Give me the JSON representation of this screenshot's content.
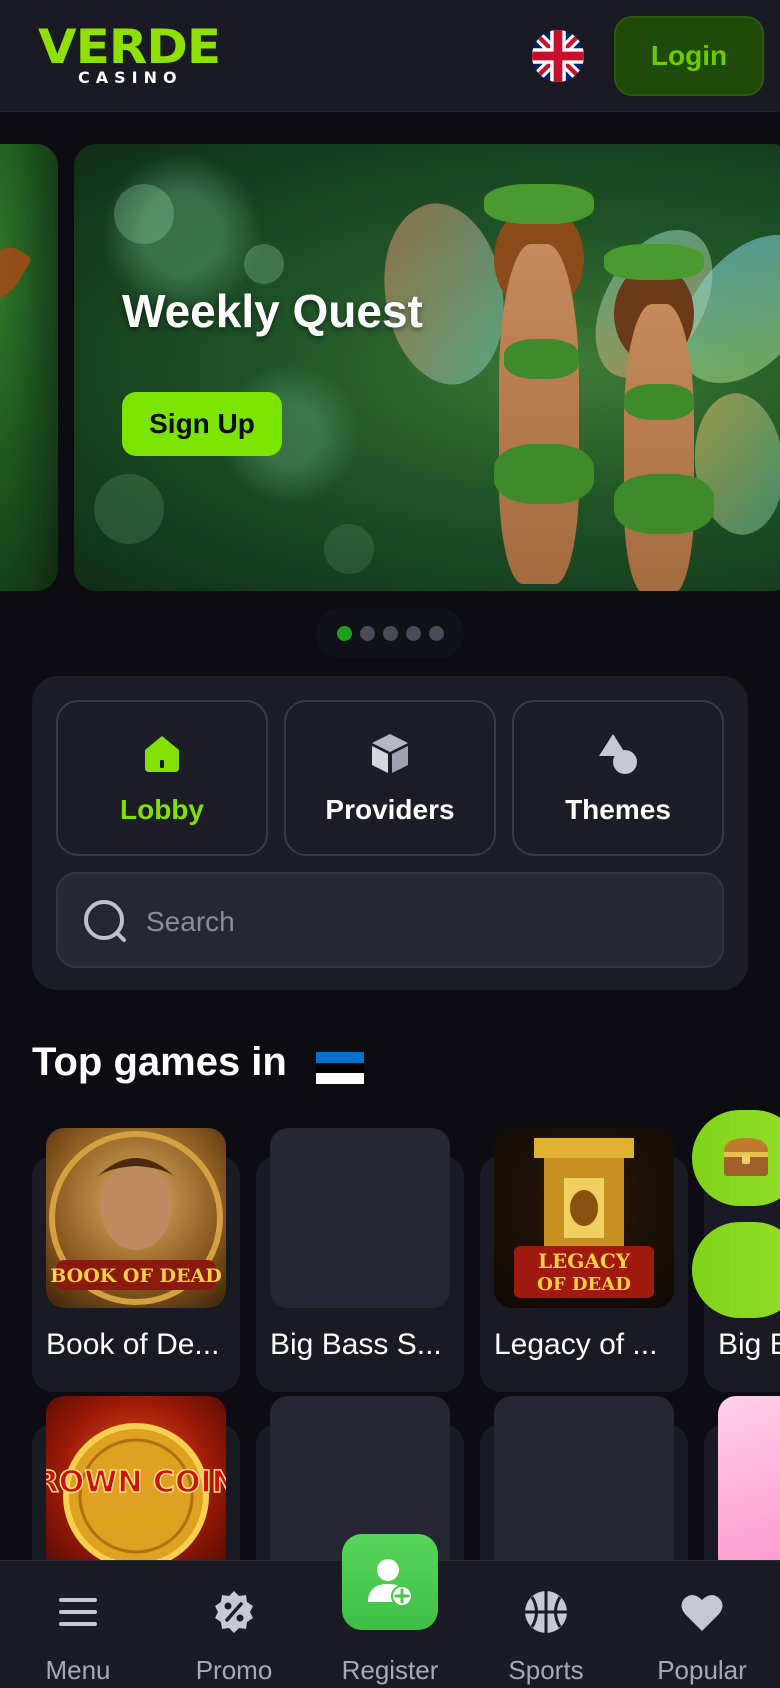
{
  "brand": {
    "name": "VERDE",
    "subtitle": "CASINO"
  },
  "header": {
    "login_label": "Login",
    "language_flag": "uk-flag-icon"
  },
  "banner": {
    "title": "Weekly Quest",
    "cta_label": "Sign Up",
    "slides": 5,
    "active_slide": 1
  },
  "nav": {
    "items": [
      {
        "label": "Lobby",
        "icon": "home-icon",
        "active": true
      },
      {
        "label": "Providers",
        "icon": "cube-icon",
        "active": false
      },
      {
        "label": "Themes",
        "icon": "shapes-icon",
        "active": false
      }
    ]
  },
  "search": {
    "placeholder": "Search"
  },
  "top_games": {
    "title": "Top games in",
    "country_flag": "estonia-flag-icon",
    "games": [
      {
        "name": "Book of De..."
      },
      {
        "name": "Big Bass S..."
      },
      {
        "name": "Legacy of ..."
      },
      {
        "name": "Big B"
      }
    ],
    "second_row": [
      {
        "name": "CROWN COINS"
      }
    ]
  },
  "bottom_nav": {
    "items": [
      {
        "label": "Menu",
        "icon": "menu-icon"
      },
      {
        "label": "Promo",
        "icon": "promo-icon"
      },
      {
        "label": "Register",
        "icon": "add-user-icon"
      },
      {
        "label": "Sports",
        "icon": "basketball-icon"
      },
      {
        "label": "Popular",
        "icon": "heart-icon"
      }
    ]
  },
  "colors": {
    "accent": "#7be400",
    "background": "#0c0c12",
    "panel": "#1d1d28"
  }
}
